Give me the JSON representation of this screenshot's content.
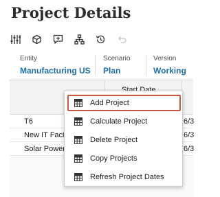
{
  "page": {
    "title": "Project Details"
  },
  "toolbar": {
    "icons": [
      "settings-sliders-icon",
      "cube-icon",
      "comment-icon",
      "hierarchy-icon",
      "history-icon",
      "undo-icon"
    ]
  },
  "pov": {
    "entity": {
      "label": "Entity",
      "value": "Manufacturing US"
    },
    "scenario": {
      "label": "Scenario",
      "value": "Plan"
    },
    "version": {
      "label": "Version",
      "value": "Working"
    }
  },
  "grid": {
    "column_header": "Start Date",
    "rows": [
      {
        "name": "T6",
        "date": "6/3"
      },
      {
        "name": "New IT Facilit",
        "date": "6/3"
      },
      {
        "name": "Solar Power C",
        "date": "6/3"
      }
    ]
  },
  "context_menu": {
    "items": [
      {
        "label": "Add Project",
        "icon": "grid-icon",
        "focused": true
      },
      {
        "label": "Calculate Project",
        "icon": "grid-icon"
      },
      {
        "label": "Delete Project",
        "icon": "grid-icon"
      },
      {
        "label": "Copy Projects",
        "icon": "grid-icon"
      },
      {
        "label": "Refresh Project Dates",
        "icon": "grid-icon"
      }
    ]
  },
  "colors": {
    "accent": "#1f6fa8",
    "focus_border": "#c8553d"
  }
}
